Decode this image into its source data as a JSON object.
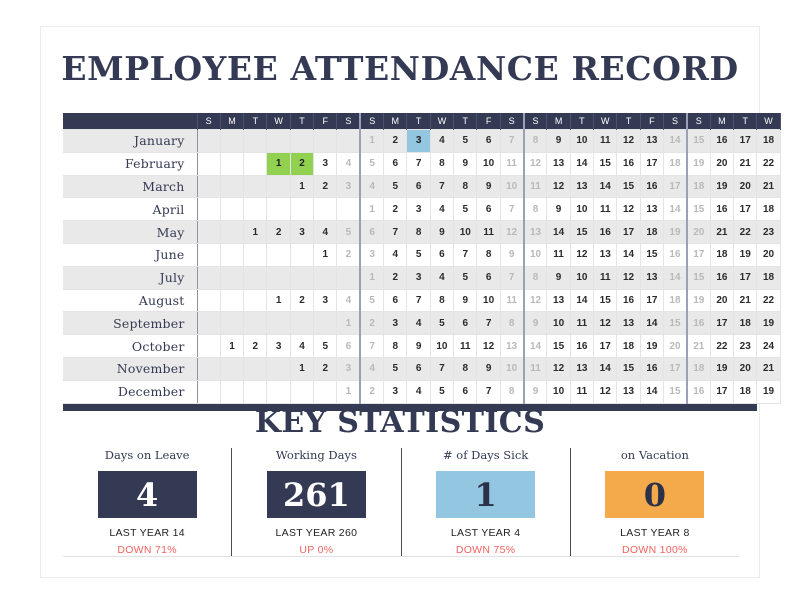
{
  "document": {
    "title": "EMPLOYEE ATTENDANCE RECORD",
    "stats_heading": "KEY STATISTICS"
  },
  "colors": {
    "navy": "#343a54",
    "green_highlight": "#92D050",
    "blue_highlight": "#93C6E0",
    "orange_highlight": "#F4A94A",
    "delta_red": "#F2635F",
    "row_alt": "#E9E9E9",
    "weekend_text": "#B9B9B9"
  },
  "calendar": {
    "month_column_header": "",
    "day_headers": [
      "S",
      "M",
      "T",
      "W",
      "T",
      "F",
      "S",
      "S",
      "M",
      "T",
      "W",
      "T",
      "F",
      "S",
      "S",
      "M",
      "T",
      "W",
      "T",
      "F",
      "S",
      "S",
      "M",
      "T",
      "W"
    ],
    "weekend_indices": [
      0,
      6,
      7,
      13,
      14,
      20,
      21
    ],
    "week_start_indices": [
      0,
      7,
      14,
      21
    ],
    "rows": [
      {
        "month": "January",
        "days": [
          "",
          "",
          "",
          "",
          "",
          "",
          "",
          1,
          2,
          3,
          4,
          5,
          6,
          7,
          8,
          9,
          10,
          11,
          12,
          13,
          14,
          15,
          16,
          17,
          18
        ],
        "highlights": {
          "9": "blue"
        }
      },
      {
        "month": "February",
        "days": [
          "",
          "",
          "",
          1,
          2,
          3,
          4,
          5,
          6,
          7,
          8,
          9,
          10,
          11,
          12,
          13,
          14,
          15,
          16,
          17,
          18,
          19,
          20,
          21,
          22
        ],
        "highlights": {
          "3": "green",
          "4": "green"
        }
      },
      {
        "month": "March",
        "days": [
          "",
          "",
          "",
          "",
          1,
          2,
          3,
          4,
          5,
          6,
          7,
          8,
          9,
          10,
          11,
          12,
          13,
          14,
          15,
          16,
          17,
          18,
          19,
          20,
          21
        ],
        "highlights": {}
      },
      {
        "month": "April",
        "days": [
          "",
          "",
          "",
          "",
          "",
          "",
          "",
          1,
          2,
          3,
          4,
          5,
          6,
          7,
          8,
          9,
          10,
          11,
          12,
          13,
          14,
          15,
          16,
          17,
          18
        ],
        "highlights": {}
      },
      {
        "month": "May",
        "days": [
          "",
          "",
          1,
          2,
          3,
          4,
          5,
          6,
          7,
          8,
          9,
          10,
          11,
          12,
          13,
          14,
          15,
          16,
          17,
          18,
          19,
          20,
          21,
          22,
          23
        ],
        "highlights": {}
      },
      {
        "month": "June",
        "days": [
          "",
          "",
          "",
          "",
          "",
          1,
          2,
          3,
          4,
          5,
          6,
          7,
          8,
          9,
          10,
          11,
          12,
          13,
          14,
          15,
          16,
          17,
          18,
          19,
          20
        ],
        "highlights": {}
      },
      {
        "month": "July",
        "days": [
          "",
          "",
          "",
          "",
          "",
          "",
          "",
          1,
          2,
          3,
          4,
          5,
          6,
          7,
          8,
          9,
          10,
          11,
          12,
          13,
          14,
          15,
          16,
          17,
          18
        ],
        "highlights": {}
      },
      {
        "month": "August",
        "days": [
          "",
          "",
          "",
          1,
          2,
          3,
          4,
          5,
          6,
          7,
          8,
          9,
          10,
          11,
          12,
          13,
          14,
          15,
          16,
          17,
          18,
          19,
          20,
          21,
          22
        ],
        "highlights": {}
      },
      {
        "month": "September",
        "days": [
          "",
          "",
          "",
          "",
          "",
          "",
          1,
          2,
          3,
          4,
          5,
          6,
          7,
          8,
          9,
          10,
          11,
          12,
          13,
          14,
          15,
          16,
          17,
          18,
          19
        ],
        "highlights": {}
      },
      {
        "month": "October",
        "days": [
          "",
          1,
          2,
          3,
          4,
          5,
          6,
          7,
          8,
          9,
          10,
          11,
          12,
          13,
          14,
          15,
          16,
          17,
          18,
          19,
          20,
          21,
          22,
          23,
          24
        ],
        "highlights": {}
      },
      {
        "month": "November",
        "days": [
          "",
          "",
          "",
          "",
          1,
          2,
          3,
          4,
          5,
          6,
          7,
          8,
          9,
          10,
          11,
          12,
          13,
          14,
          15,
          16,
          17,
          18,
          19,
          20,
          21
        ],
        "highlights": {}
      },
      {
        "month": "December",
        "days": [
          "",
          "",
          "",
          "",
          "",
          "",
          1,
          2,
          3,
          4,
          5,
          6,
          7,
          8,
          9,
          10,
          11,
          12,
          13,
          14,
          15,
          16,
          17,
          18,
          19
        ],
        "highlights": {}
      }
    ]
  },
  "statistics": [
    {
      "label": "Days on Leave",
      "value": "4",
      "box_style": "navy",
      "last_year": "LAST YEAR  14",
      "delta": "DOWN 71%"
    },
    {
      "label": "Working Days",
      "value": "261",
      "box_style": "navy",
      "last_year": "LAST YEAR 260",
      "delta": "UP 0%"
    },
    {
      "label": "# of Days Sick",
      "value": "1",
      "box_style": "blue",
      "last_year": "LAST YEAR 4",
      "delta": "DOWN 75%"
    },
    {
      "label": "on Vacation",
      "value": "0",
      "box_style": "orange",
      "last_year": "LAST YEAR 8",
      "delta": "DOWN 100%"
    }
  ]
}
